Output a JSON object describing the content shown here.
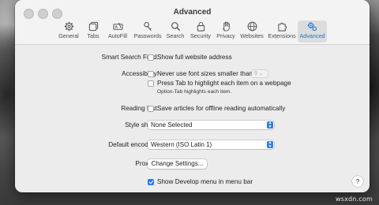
{
  "window": {
    "title": "Advanced"
  },
  "tabs": [
    {
      "label": "General",
      "icon": "gear-icon"
    },
    {
      "label": "Tabs",
      "icon": "tabs-icon"
    },
    {
      "label": "AutoFill",
      "icon": "autofill-icon"
    },
    {
      "label": "Passwords",
      "icon": "key-icon"
    },
    {
      "label": "Search",
      "icon": "search-icon"
    },
    {
      "label": "Security",
      "icon": "lock-icon"
    },
    {
      "label": "Privacy",
      "icon": "hand-icon"
    },
    {
      "label": "Websites",
      "icon": "globe-icon"
    },
    {
      "label": "Extensions",
      "icon": "puzzle-icon"
    },
    {
      "label": "Advanced",
      "icon": "gears-icon",
      "active": true
    }
  ],
  "settings": {
    "smart_search": {
      "label": "Smart Search Field:",
      "option": "Show full website address",
      "checked": false
    },
    "accessibility": {
      "label": "Accessibility:",
      "font_option": "Never use font sizes smaller than",
      "font_size": "9",
      "tab_option": "Press Tab to highlight each item on a webpage",
      "tab_hint": "Option-Tab highlights each item."
    },
    "reading_list": {
      "label": "Reading List:",
      "option": "Save articles for offline reading automatically"
    },
    "style_sheet": {
      "label": "Style sheet:",
      "value": "None Selected"
    },
    "encoding": {
      "label": "Default encoding:",
      "value": "Western (ISO Latin 1)"
    },
    "proxies": {
      "label": "Proxies:",
      "button": "Change Settings..."
    },
    "develop": {
      "option": "Show Develop menu in menu bar",
      "checked": true
    }
  },
  "help_label": "?",
  "watermark": "wsxdn.com",
  "colors": {
    "accent": "#2b7de9",
    "active_tab_text": "#1a73d9"
  }
}
